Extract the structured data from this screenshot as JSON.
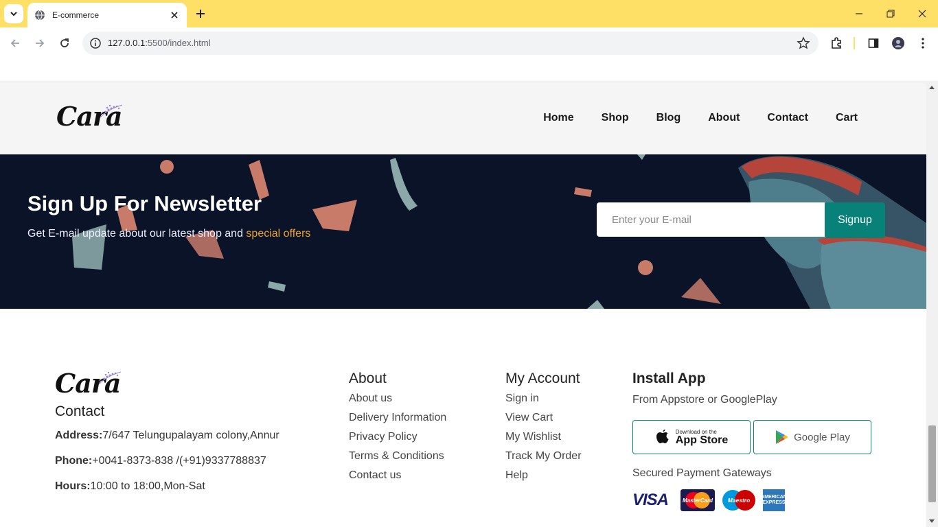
{
  "browser": {
    "tab_title": "E-commerce",
    "url_host": "127.0.0.1",
    "url_path": ":5500/index.html",
    "accent_color": "#fde065"
  },
  "header": {
    "logo": "Cara",
    "nav": [
      "Home",
      "Shop",
      "Blog",
      "About",
      "Contact",
      "Cart"
    ]
  },
  "newsletter": {
    "title": "Sign Up For Newsletter",
    "subtitle_pre": "Get E-mail update about our latest shop and ",
    "subtitle_highlight": "special offers",
    "input_placeholder": "Enter your E-mail",
    "button_label": "Signup",
    "button_color": "#088178",
    "highlight_color": "#f0a12a"
  },
  "footer": {
    "logo": "Cara",
    "contact": {
      "heading": "Contact",
      "address_label": "Address:",
      "address_value": "7/647 Telungupalayam colony,Annur",
      "phone_label": "Phone:",
      "phone_value": "+0041-8373-838 /(+91)9337788837",
      "hours_label": "Hours:",
      "hours_value": "10:00 to 18:00,Mon-Sat"
    },
    "about": {
      "heading": "About",
      "links": [
        "About us",
        "Delivery Information",
        "Privacy Policy",
        "Terms & Conditions",
        "Contact us"
      ]
    },
    "account": {
      "heading": "My Account",
      "links": [
        "Sign in",
        "View Cart",
        "My Wishlist",
        "Track My Order",
        "Help"
      ]
    },
    "install": {
      "heading": "Install App",
      "subtitle": "From Appstore or GooglePlay",
      "appstore_small": "Download on the",
      "appstore_big": "App Store",
      "googleplay": "Google Play",
      "payment_label": "Secured Payment Gateways",
      "payment_methods": [
        "VISA",
        "MasterCard",
        "Maestro",
        "AMERICAN EXPRESS"
      ]
    }
  }
}
